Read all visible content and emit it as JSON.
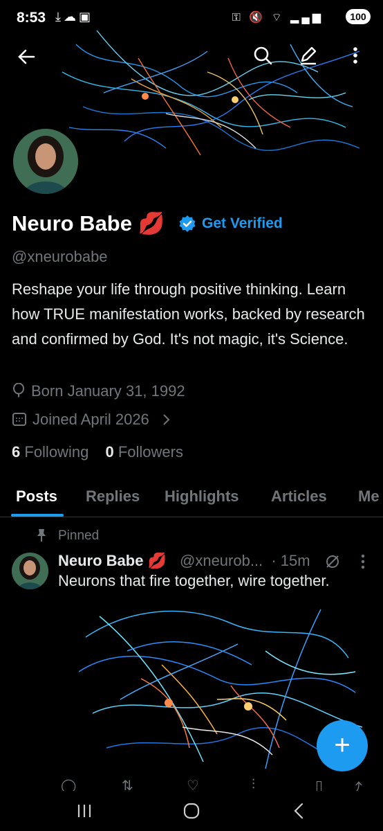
{
  "status_bar": {
    "time": "8:53",
    "battery": "100"
  },
  "profile": {
    "name": "Neuro Babe",
    "name_emoji": "💋",
    "get_verified": "Get Verified",
    "handle": "@xneurobabe",
    "bio": "Reshape your life through positive thinking. Learn how TRUE manifestation works, backed by research and confirmed by God. It's not magic, it's Science.",
    "born": "Born January 31, 1992",
    "joined": "Joined April 2026",
    "following_count": "6",
    "following_label": "Following",
    "followers_count": "0",
    "followers_label": "Followers"
  },
  "tabs": [
    "Posts",
    "Replies",
    "Highlights",
    "Articles",
    "Me"
  ],
  "post": {
    "pinned_label": "Pinned",
    "name": "Neuro Babe",
    "emoji": "💋",
    "handle": "@xneurob...",
    "time": "· 15m",
    "text": "Neurons that fire together, wire together."
  },
  "fab_label": "+",
  "colors": {
    "accent": "#1d9bf0",
    "muted": "#71767b",
    "text": "#e7e9ea",
    "background": "#000000"
  }
}
